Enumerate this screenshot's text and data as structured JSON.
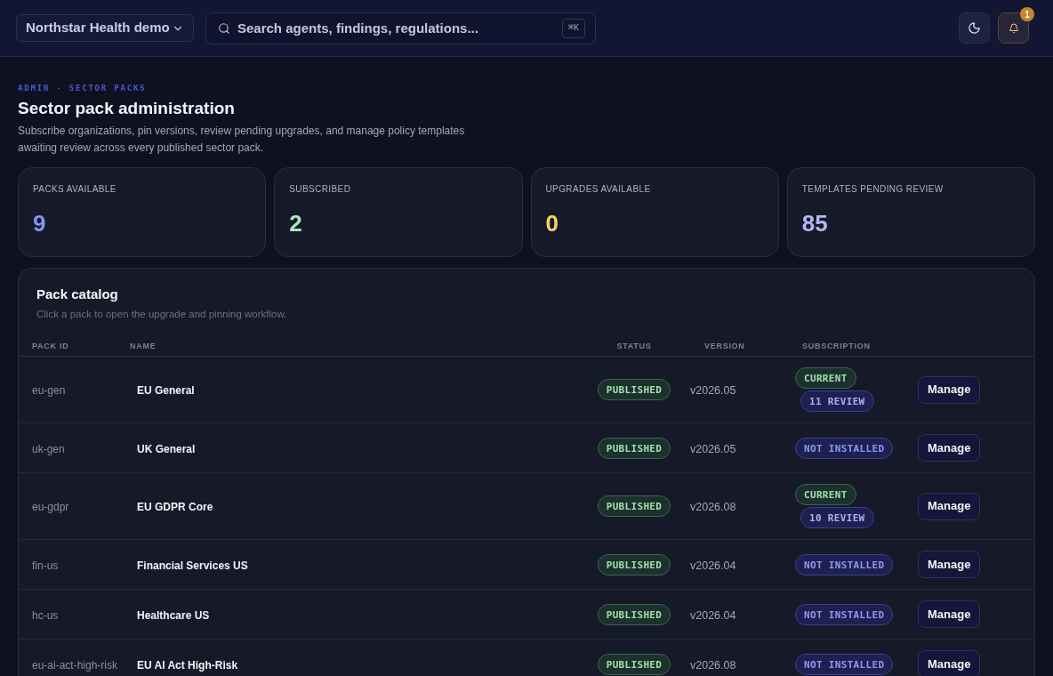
{
  "header": {
    "org_selector": "Northstar Health demo",
    "search": {
      "placeholder": "Search agents, findings, regulations...",
      "shortcut": "⌘K"
    },
    "notifications": {
      "count": "1"
    }
  },
  "page": {
    "breadcrumb": "ADMIN · SECTOR PACKS",
    "title": "Sector pack administration",
    "description": "Subscribe organizations, pin versions, review pending upgrades, and manage policy templates awaiting review across every published sector pack."
  },
  "stats": [
    {
      "label": "PACKS AVAILABLE",
      "value": "9",
      "color": "#8b93f0"
    },
    {
      "label": "SUBSCRIBED",
      "value": "2",
      "color": "#a8e6bd"
    },
    {
      "label": "UPGRADES AVAILABLE",
      "value": "0",
      "color": "#f0d56b"
    },
    {
      "label": "TEMPLATES PENDING REVIEW",
      "value": "85",
      "color": "#b3b8f6"
    }
  ],
  "catalog": {
    "title": "Pack catalog",
    "subtitle": "Click a pack to open the upgrade and pinning workflow.",
    "columns": [
      "PACK ID",
      "NAME",
      "STATUS",
      "VERSION",
      "SUBSCRIPTION"
    ],
    "rows": [
      {
        "pack_id": "eu-gen",
        "name": "EU General",
        "status": {
          "kind": "published",
          "label": "PUBLISHED"
        },
        "version": "v2026.05",
        "subscription": [
          {
            "kind": "current",
            "label": "CURRENT"
          },
          {
            "kind": "review",
            "label": "11 REVIEW"
          }
        ],
        "action": "Manage"
      },
      {
        "pack_id": "uk-gen",
        "name": "UK General",
        "status": {
          "kind": "published",
          "label": "PUBLISHED"
        },
        "version": "v2026.05",
        "subscription": [
          {
            "kind": "not_installed",
            "label": "NOT INSTALLED"
          }
        ],
        "action": "Manage"
      },
      {
        "pack_id": "eu-gdpr",
        "name": "EU GDPR Core",
        "status": {
          "kind": "published",
          "label": "PUBLISHED"
        },
        "version": "v2026.08",
        "subscription": [
          {
            "kind": "current",
            "label": "CURRENT"
          },
          {
            "kind": "review",
            "label": "10 REVIEW"
          }
        ],
        "action": "Manage"
      },
      {
        "pack_id": "fin-us",
        "name": "Financial Services US",
        "status": {
          "kind": "published",
          "label": "PUBLISHED"
        },
        "version": "v2026.04",
        "subscription": [
          {
            "kind": "not_installed",
            "label": "NOT INSTALLED"
          }
        ],
        "action": "Manage"
      },
      {
        "pack_id": "hc-us",
        "name": "Healthcare US",
        "status": {
          "kind": "published",
          "label": "PUBLISHED"
        },
        "version": "v2026.04",
        "subscription": [
          {
            "kind": "not_installed",
            "label": "NOT INSTALLED"
          }
        ],
        "action": "Manage"
      },
      {
        "pack_id": "eu-ai-act-high-risk",
        "name": "EU AI Act High-Risk",
        "status": {
          "kind": "published",
          "label": "PUBLISHED"
        },
        "version": "v2026.08",
        "subscription": [
          {
            "kind": "not_installed",
            "label": "NOT INSTALLED"
          }
        ],
        "action": "Manage"
      }
    ]
  }
}
